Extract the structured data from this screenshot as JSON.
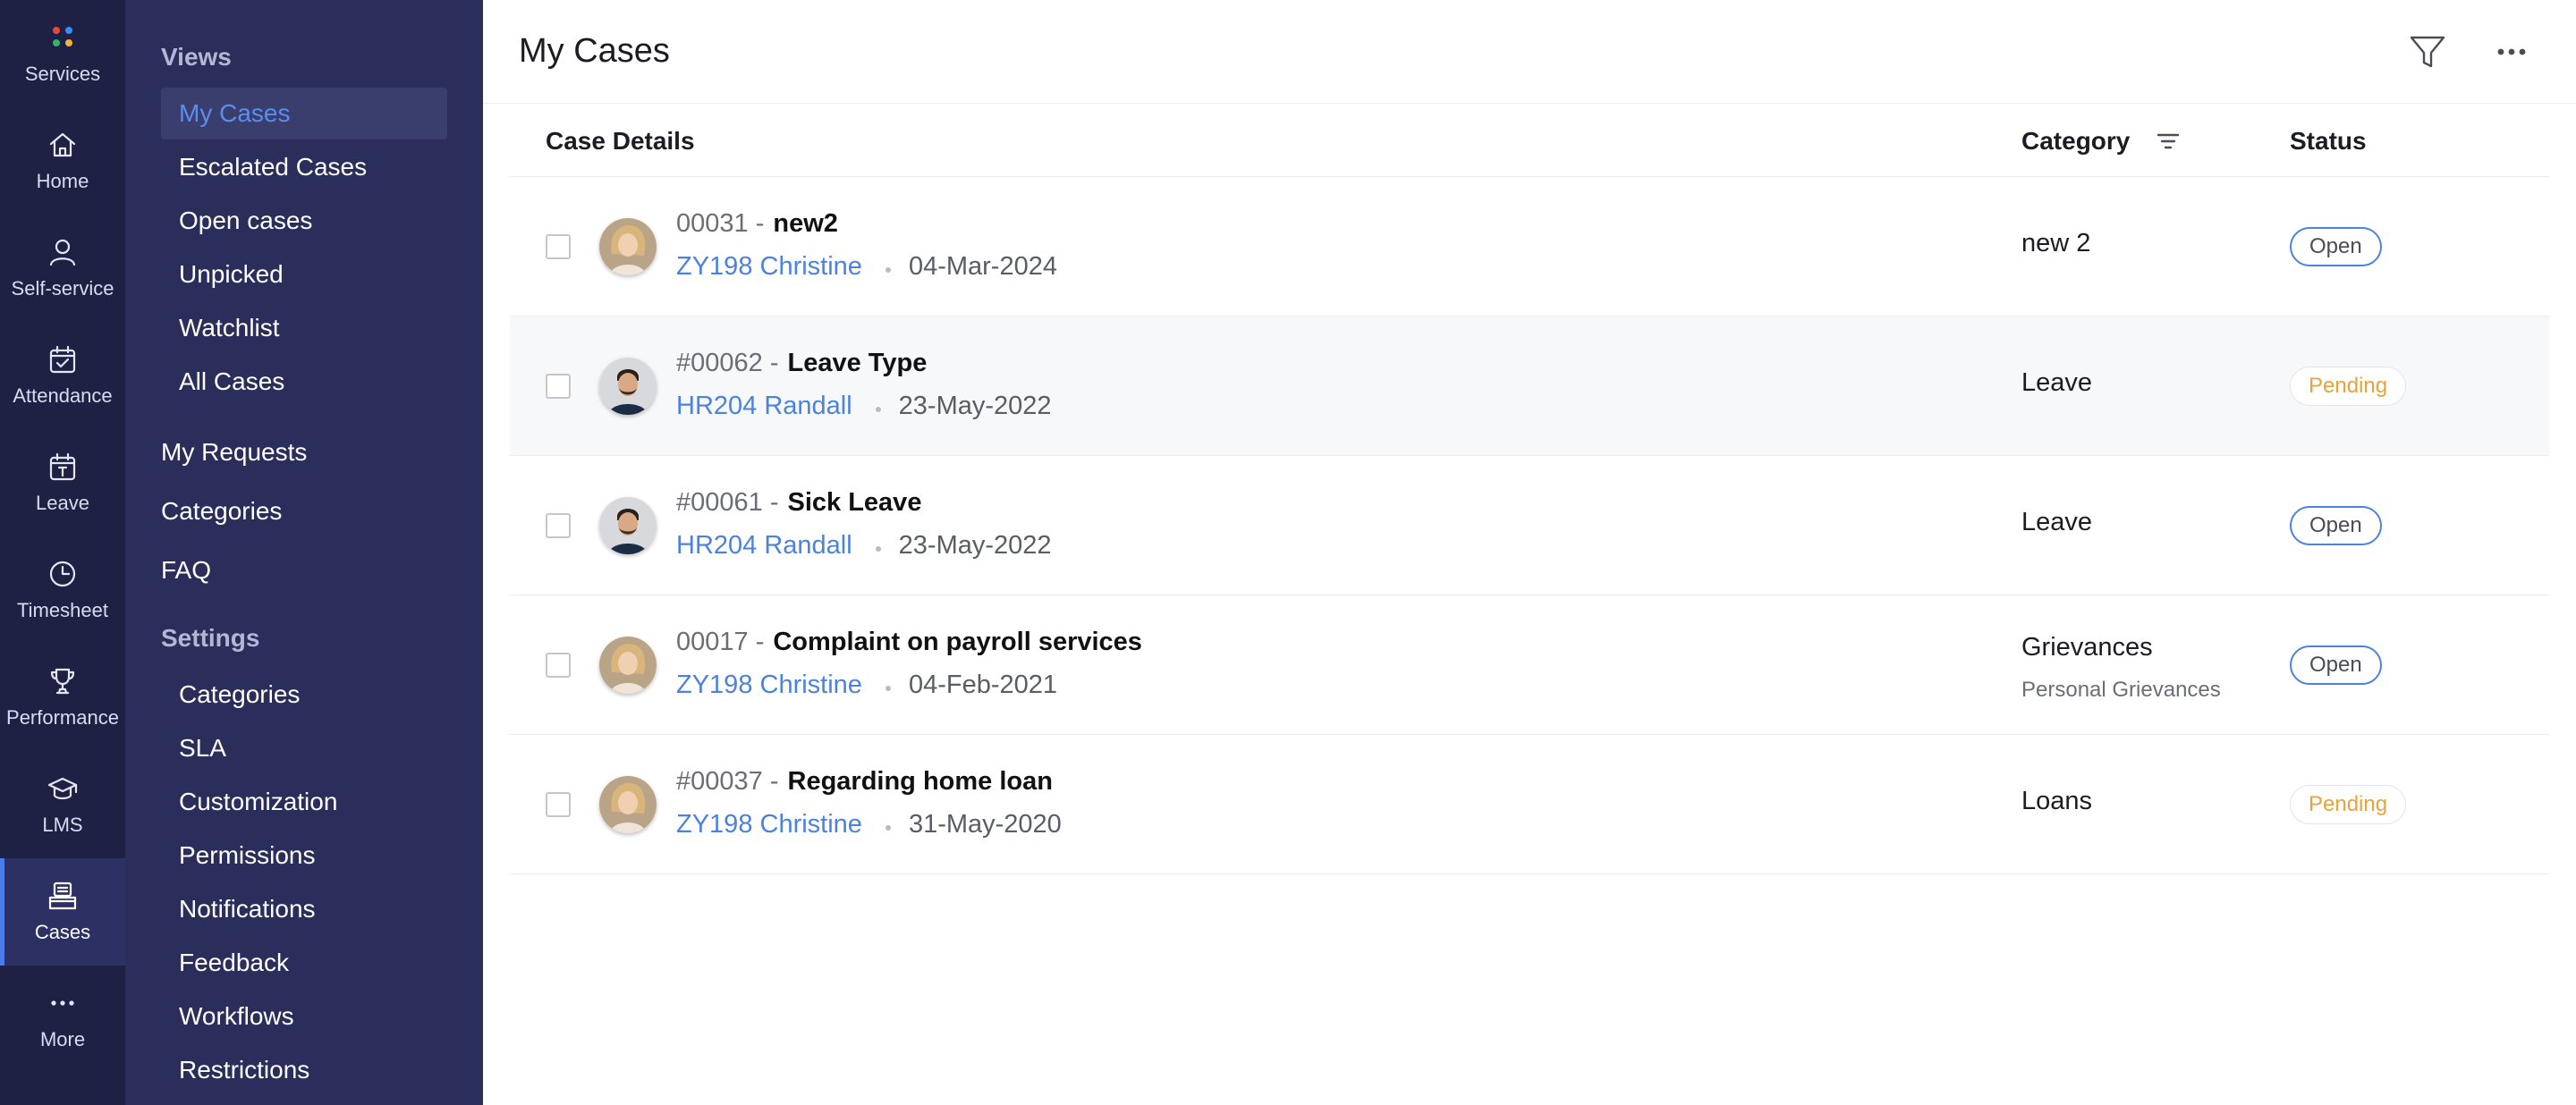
{
  "rail": {
    "items": [
      {
        "key": "services",
        "label": "Services",
        "icon": "apps-dots-icon"
      },
      {
        "key": "home",
        "label": "Home",
        "icon": "home-icon"
      },
      {
        "key": "self-service",
        "label": "Self-service",
        "icon": "person-icon"
      },
      {
        "key": "attendance",
        "label": "Attendance",
        "icon": "calendar-check-icon"
      },
      {
        "key": "leave",
        "label": "Leave",
        "icon": "calendar-leave-icon"
      },
      {
        "key": "timesheet",
        "label": "Timesheet",
        "icon": "clock-icon"
      },
      {
        "key": "performance",
        "label": "Performance",
        "icon": "trophy-icon"
      },
      {
        "key": "lms",
        "label": "LMS",
        "icon": "graduation-cap-icon"
      },
      {
        "key": "cases",
        "label": "Cases",
        "icon": "cases-tray-icon",
        "active": true
      },
      {
        "key": "more",
        "label": "More",
        "icon": "ellipsis-icon"
      }
    ]
  },
  "sidebar": {
    "views_title": "Views",
    "views": [
      "My Cases",
      "Escalated Cases",
      "Open cases",
      "Unpicked",
      "Watchlist",
      "All Cases"
    ],
    "active_view": "My Cases",
    "links": [
      "My Requests",
      "Categories",
      "FAQ"
    ],
    "settings_title": "Settings",
    "settings": [
      "Categories",
      "SLA",
      "Customization",
      "Permissions",
      "Notifications",
      "Feedback",
      "Workflows",
      "Restrictions"
    ]
  },
  "header": {
    "title": "My Cases",
    "filter_icon": "funnel-icon",
    "more_icon": "ellipsis-icon"
  },
  "table": {
    "columns": {
      "details": "Case Details",
      "category": "Category",
      "status": "Status"
    },
    "rows": [
      {
        "id": "00031 -",
        "title": "new2",
        "employee": "ZY198 Christine",
        "date": "04-Mar-2024",
        "category": "new 2",
        "subcategory": "",
        "status": "Open",
        "status_kind": "open",
        "avatar": "female"
      },
      {
        "id": "#00062 -",
        "title": "Leave Type",
        "employee": "HR204 Randall",
        "date": "23-May-2022",
        "category": "Leave",
        "subcategory": "",
        "status": "Pending",
        "status_kind": "pending",
        "avatar": "male"
      },
      {
        "id": "#00061 -",
        "title": "Sick Leave",
        "employee": "HR204 Randall",
        "date": "23-May-2022",
        "category": "Leave",
        "subcategory": "",
        "status": "Open",
        "status_kind": "open",
        "avatar": "male"
      },
      {
        "id": "00017 -",
        "title": "Complaint on payroll services",
        "employee": "ZY198 Christine",
        "date": "04-Feb-2021",
        "category": "Grievances",
        "subcategory": "Personal Grievances",
        "status": "Open",
        "status_kind": "open",
        "avatar": "female"
      },
      {
        "id": "#00037 -",
        "title": "Regarding home loan",
        "employee": "ZY198 Christine",
        "date": "31-May-2020",
        "category": "Loans",
        "subcategory": "",
        "status": "Pending",
        "status_kind": "pending",
        "avatar": "female"
      }
    ]
  },
  "colors": {
    "rail_bg": "#1e2143",
    "sidebar_bg": "#2b2e5a",
    "accent_blue": "#4b82e0",
    "pending_orange": "#e8a33a"
  }
}
